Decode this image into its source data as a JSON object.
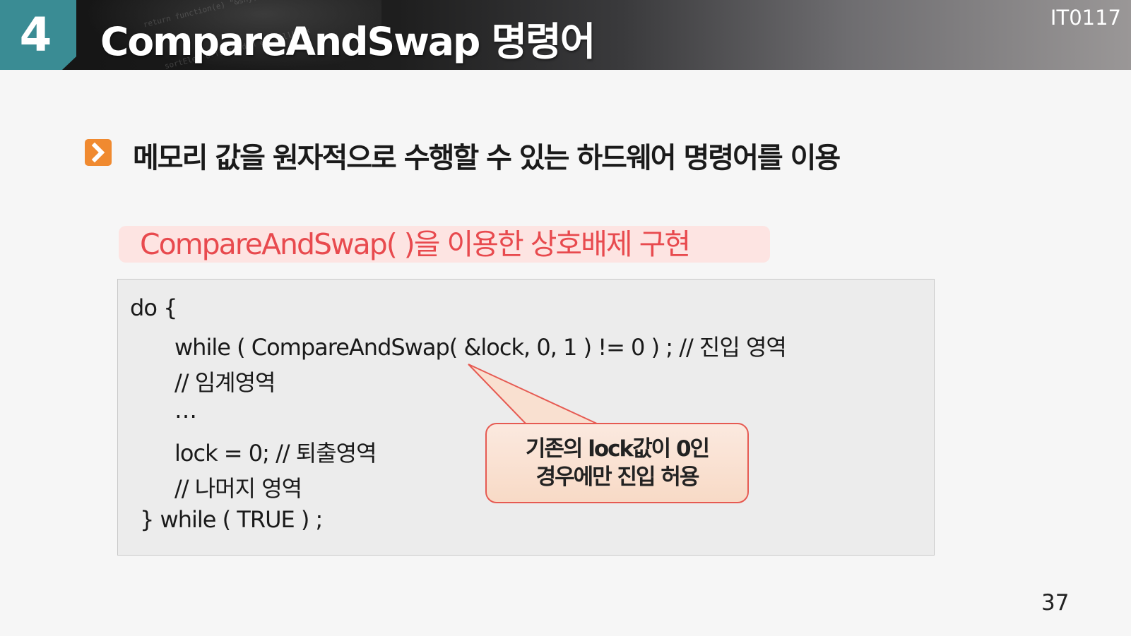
{
  "header": {
    "section_number": "4",
    "title": "CompareAndSwap 명령어",
    "course_code": "IT0117"
  },
  "bullet_icon": "chevron-right-icon",
  "heading": "메모리 값을 원자적으로 수행할 수 있는 하드웨어 명령어를 이용",
  "subheading": "CompareAndSwap( )을 이용한 상호배제 구현",
  "code_lines": [
    "do {",
    "while ( CompareAndSwap( &lock, 0, 1 ) != 0 ) ; // 진입 영역",
    "// 임계영역",
    "…",
    "lock = 0;  // 퇴출영역",
    "// 나머지 영역",
    "} while ( TRUE ) ;"
  ],
  "callout": {
    "line1": "기존의 lock값이 0인",
    "line2": "경우에만 진입 허용"
  },
  "page_number": "37",
  "colors": {
    "section_badge": "#3a8c94",
    "bullet": "#f08a30",
    "subheading_text": "#e84a4e",
    "subheading_bg": "#fde4e2",
    "callout_border": "#e65a52",
    "callout_bg": "#f8dac6"
  }
}
